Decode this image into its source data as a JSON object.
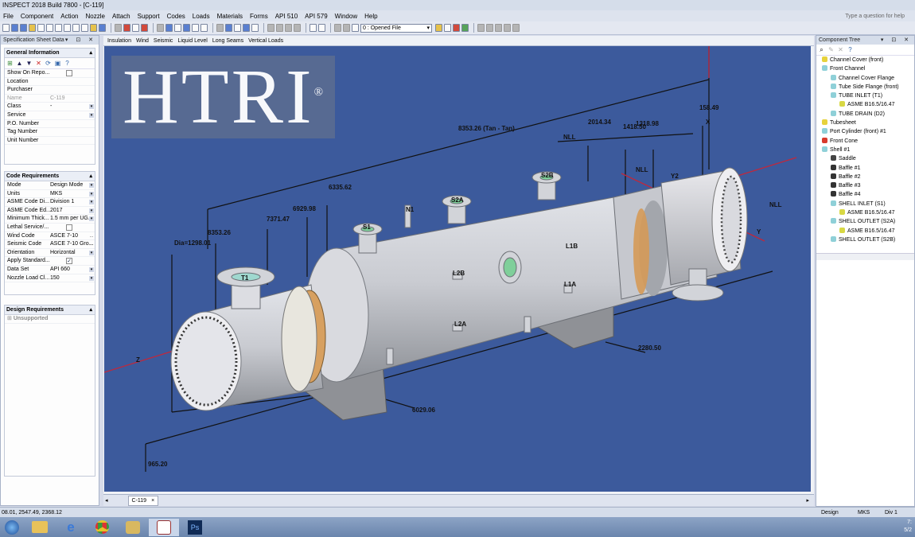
{
  "window": {
    "title": "INSPECT 2018 Build 7800 - [C-119]"
  },
  "menu": {
    "items": [
      "File",
      "Component",
      "Action",
      "Nozzle",
      "Attach",
      "Support",
      "Codes",
      "Loads",
      "Materials",
      "Forms",
      "API 510",
      "API 579",
      "Window",
      "Help"
    ],
    "help_placeholder": "Type a question for help"
  },
  "toolbar": {
    "opened_file": "0 : Opened File"
  },
  "spec_panel": {
    "title": "Specification Sheet Data",
    "general": {
      "title": "General Information",
      "rows": [
        {
          "k": "Show On Repo...",
          "v": "",
          "type": "check"
        },
        {
          "k": "Location",
          "v": ""
        },
        {
          "k": "Purchaser",
          "v": ""
        },
        {
          "k": "Name",
          "v": "C-119",
          "grey": true
        },
        {
          "k": "Class",
          "v": "-",
          "type": "dd"
        },
        {
          "k": "Service",
          "v": "",
          "type": "dd"
        },
        {
          "k": "P.O. Number",
          "v": ""
        },
        {
          "k": "Tag Number",
          "v": ""
        },
        {
          "k": "Unit Number",
          "v": ""
        }
      ]
    },
    "code": {
      "title": "Code Requirements",
      "rows": [
        {
          "k": "Mode",
          "v": "Design Mode",
          "type": "dd"
        },
        {
          "k": "Units",
          "v": "MKS",
          "type": "dd"
        },
        {
          "k": "ASME Code Di...",
          "v": "Division 1",
          "type": "dd"
        },
        {
          "k": "ASME Code Ed...",
          "v": "2017",
          "type": "dd"
        },
        {
          "k": "Minimum Thick...",
          "v": "1.5 mm per UG...",
          "type": "dd"
        },
        {
          "k": "Lethal Service/...",
          "v": "",
          "type": "check"
        },
        {
          "k": "Wind Code",
          "v": "ASCE 7-10",
          "type": "more"
        },
        {
          "k": "Seismic Code",
          "v": "ASCE 7-10 Gro...",
          "type": "more"
        },
        {
          "k": "Orientation",
          "v": "Horizontal",
          "type": "dd"
        },
        {
          "k": "Apply Standard...",
          "v": "",
          "type": "checked"
        },
        {
          "k": "Data Set",
          "v": "API 660",
          "type": "dd"
        },
        {
          "k": "Nozzle Load Cl...",
          "v": "150",
          "type": "dd"
        }
      ]
    },
    "design": {
      "title": "Design Requirements",
      "item": "Unsupported"
    }
  },
  "view_tabs": [
    "Insulation",
    "Wind",
    "Seismic",
    "Liquid Level",
    "Long Seams",
    "Vertical Loads"
  ],
  "logo": {
    "text": "HTRI",
    "mark": "®"
  },
  "dimensions": [
    "8353.26 (Tan - Tan)",
    "2014.34",
    "1418.50",
    "1318.98",
    "158.49",
    "6335.62",
    "6929.98",
    "7371.47",
    "8353.26",
    "Dia=1298.01",
    "2280.50",
    "6029.06",
    "965.20",
    "NLL",
    "NLL",
    "NLL"
  ],
  "axis_labels": [
    "X",
    "Y",
    "Z",
    "Y2"
  ],
  "nozzle_labels": [
    "T1",
    "S1",
    "S2A",
    "S2B",
    "N1",
    "L2B",
    "L1B",
    "L1A",
    "L2A"
  ],
  "doc_tab": {
    "label": "C-119",
    "close": "×"
  },
  "tree_panel": {
    "title": "Component Tree",
    "items": [
      {
        "label": "Channel Cover (front)",
        "indent": 1,
        "color": "#e6d23c"
      },
      {
        "label": "Front Channel",
        "indent": 1,
        "color": "#8fd0d8"
      },
      {
        "label": "Channel Cover Flange",
        "indent": 2,
        "color": "#8fd0d8"
      },
      {
        "label": "Tube Side Flange (front)",
        "indent": 2,
        "color": "#8fd0d8"
      },
      {
        "label": "TUBE INLET (T1)",
        "indent": 2,
        "color": "#8fd0d8"
      },
      {
        "label": "ASME B16.5/16.47",
        "indent": 3,
        "color": "#d8d844"
      },
      {
        "label": "TUBE DRAIN (D2)",
        "indent": 2,
        "color": "#8fd0d8"
      },
      {
        "label": "Tubesheet",
        "indent": 1,
        "color": "#e6d23c"
      },
      {
        "label": "Port Cylinder (front) #1",
        "indent": 1,
        "color": "#8fd0d8"
      },
      {
        "label": "Front Cone",
        "indent": 1,
        "color": "#d83a2c"
      },
      {
        "label": "Shell #1",
        "indent": 1,
        "color": "#8fd0d8"
      },
      {
        "label": "Saddle",
        "indent": 2,
        "color": "#444"
      },
      {
        "label": "Baffle #1",
        "indent": 2,
        "color": "#333"
      },
      {
        "label": "Baffle #2",
        "indent": 2,
        "color": "#333"
      },
      {
        "label": "Baffle #3",
        "indent": 2,
        "color": "#333"
      },
      {
        "label": "Baffle #4",
        "indent": 2,
        "color": "#333"
      },
      {
        "label": "SHELL INLET (S1)",
        "indent": 2,
        "color": "#8fd0d8"
      },
      {
        "label": "ASME B16.5/16.47",
        "indent": 3,
        "color": "#d8d844"
      },
      {
        "label": "SHELL OUTLET (S2A)",
        "indent": 2,
        "color": "#8fd0d8"
      },
      {
        "label": "ASME B16.5/16.47",
        "indent": 3,
        "color": "#d8d844"
      },
      {
        "label": "SHELL OUTLET (S2B)",
        "indent": 2,
        "color": "#8fd0d8"
      }
    ]
  },
  "status": {
    "coords": "08.01, 2547.49, 2368.12",
    "mode": "Design",
    "units": "MKS",
    "div": "Div 1"
  },
  "taskbar": {
    "clock": "7:",
    "date": "5/2"
  }
}
